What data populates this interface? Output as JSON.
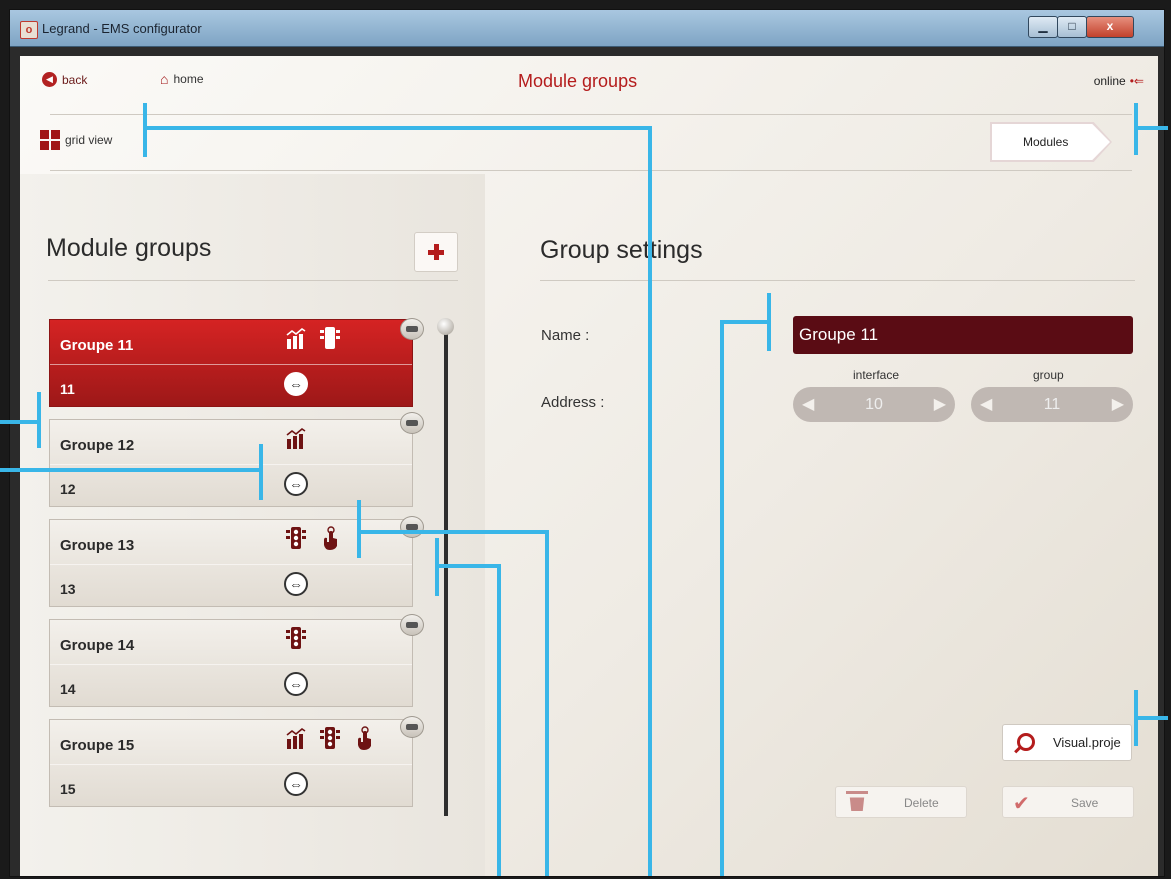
{
  "window": {
    "title": "Legrand - EMS configurator",
    "minimize": "▁",
    "maximize": "□",
    "close": "x"
  },
  "topbar": {
    "back_label": "back",
    "home_label": "home",
    "page_title": "Module groups",
    "status_label": "online",
    "status_icon": "usb-icon"
  },
  "toolbar": {
    "grid_view_label": "grid view",
    "modules_label": "Modules"
  },
  "groups_panel": {
    "title": "Module groups",
    "add_label": "+",
    "groups": [
      {
        "name": "Groupe  11",
        "address": "11",
        "icons": [
          "chart-icon",
          "traffic-light-icon"
        ],
        "active": true
      },
      {
        "name": "Groupe  12",
        "address": "12",
        "icons": [
          "chart-icon"
        ],
        "active": false
      },
      {
        "name": "Groupe  13",
        "address": "13",
        "icons": [
          "traffic-light-icon",
          "hand-pointer-icon"
        ],
        "active": false
      },
      {
        "name": "Groupe  14",
        "address": "14",
        "icons": [
          "traffic-light-icon"
        ],
        "active": false
      },
      {
        "name": "Groupe  15",
        "address": "15",
        "icons": [
          "chart-icon",
          "traffic-light-icon",
          "hand-pointer-icon"
        ],
        "active": false
      }
    ]
  },
  "settings": {
    "title": "Group settings",
    "name_label": "Name :",
    "name_value": "Groupe  11",
    "address_label": "Address :",
    "interface_label": "interface",
    "interface_value": "10",
    "group_label": "group",
    "group_value": "11"
  },
  "actions": {
    "visual_label": "Visual.proje",
    "delete_label": "Delete",
    "save_label": "Save"
  },
  "colors": {
    "accent": "#b41c1c",
    "active_card": "#c21e1e",
    "name_field": "#5a0c14",
    "annotation": "#39b6e8"
  }
}
